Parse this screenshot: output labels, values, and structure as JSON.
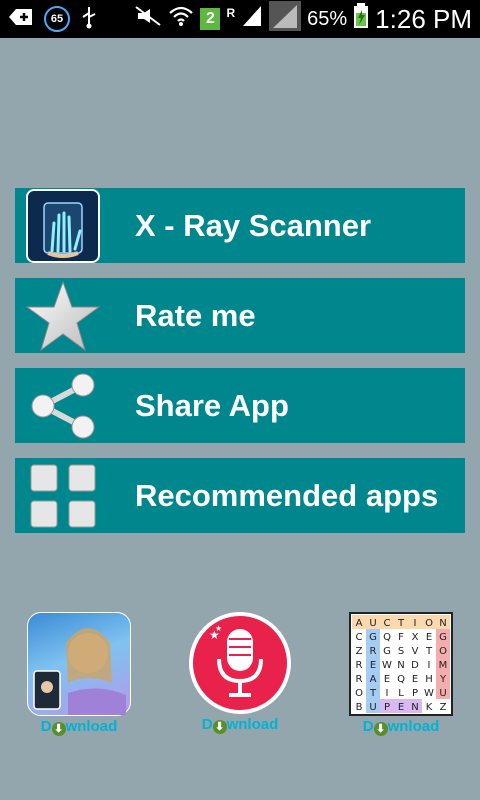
{
  "status_bar": {
    "notification_count": "65",
    "sim_slot": "2",
    "roaming": "R",
    "battery": "65%",
    "time": "1:26 PM"
  },
  "menu": [
    {
      "label": "X - Ray Scanner",
      "icon": "xray-hand-icon"
    },
    {
      "label": "Rate me",
      "icon": "star-icon"
    },
    {
      "label": "Share App",
      "icon": "share-icon"
    },
    {
      "label": "Recommended apps",
      "icon": "grid-icon"
    }
  ],
  "promos": [
    {
      "icon": "photo-app-icon",
      "download_label_prefix": "D",
      "download_label_suffix": "wnload"
    },
    {
      "icon": "voice-recorder-icon",
      "download_label_prefix": "D",
      "download_label_suffix": "wnload"
    },
    {
      "icon": "word-search-icon",
      "download_label_prefix": "D",
      "download_label_suffix": "wnload",
      "grid_rows": [
        "AUCTION",
        "CGQFXEG",
        "ZRGSVTO",
        "REWNDIM",
        "RAEQEHY",
        "OTILPWU",
        "BUPENKZ"
      ]
    }
  ]
}
